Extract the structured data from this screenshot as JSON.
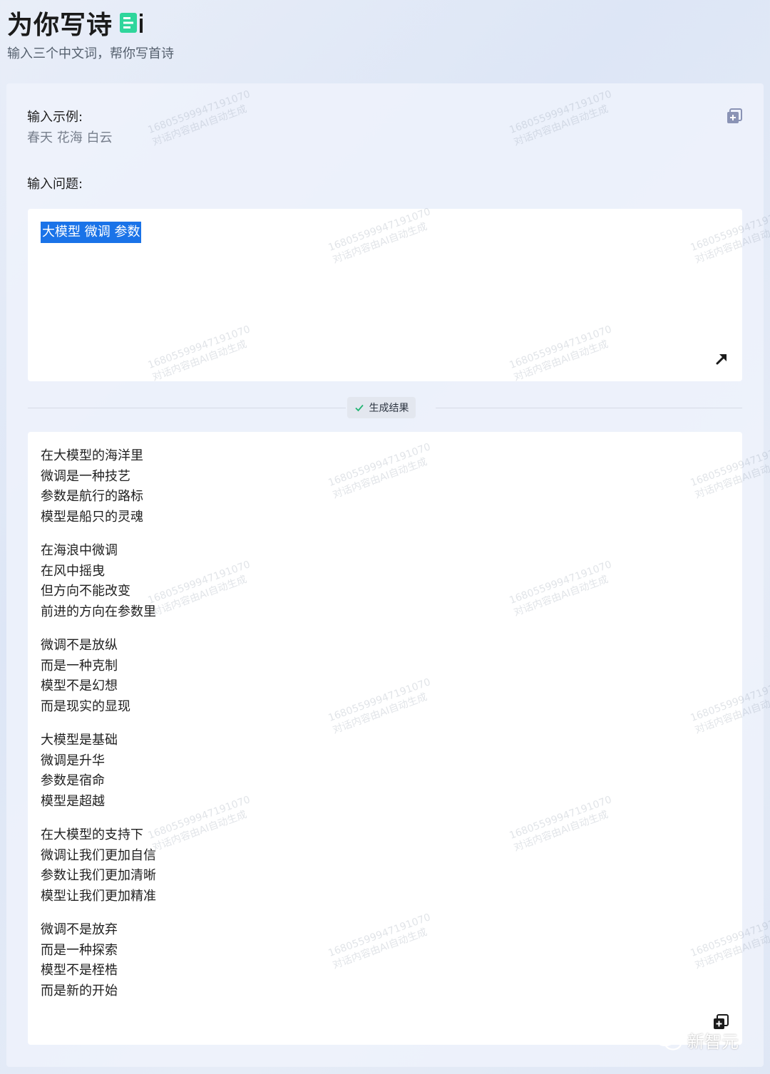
{
  "header": {
    "title": "为你写诗",
    "subtitle": "输入三个中文词，帮你写首诗"
  },
  "example": {
    "label": "输入示例:",
    "value": "春天 花海 白云"
  },
  "question": {
    "label": "输入问题:",
    "value": "大模型 微调 参数"
  },
  "result": {
    "badge_label": "生成结果",
    "stanzas": [
      [
        "在大模型的海洋里",
        "微调是一种技艺",
        "参数是航行的路标",
        "模型是船只的灵魂"
      ],
      [
        "在海浪中微调",
        "在风中摇曳",
        "但方向不能改变",
        "前进的方向在参数里"
      ],
      [
        "微调不是放纵",
        "而是一种克制",
        "模型不是幻想",
        "而是现实的显现"
      ],
      [
        "大模型是基础",
        "微调是升华",
        "参数是宿命",
        "模型是超越"
      ],
      [
        "在大模型的支持下",
        "微调让我们更加自信",
        "参数让我们更加清晰",
        "模型让我们更加精准"
      ],
      [
        "微调不是放弃",
        "而是一种探索",
        "模型不是桎梏",
        "而是新的开始"
      ]
    ]
  },
  "watermark": {
    "line1": "16805599947191070",
    "line2": "对话内容由AI自动生成"
  },
  "footer": {
    "brand": "新智元"
  },
  "colors": {
    "accent_green": "#2fd69c",
    "selection_blue": "#1a73e8",
    "check_green": "#22b573"
  },
  "icons": {
    "brand": "ai-brand-icon",
    "copy": "copy-plus-icon",
    "expand": "expand-arrow-icon",
    "check": "check-icon",
    "wechat": "wechat-icon"
  }
}
